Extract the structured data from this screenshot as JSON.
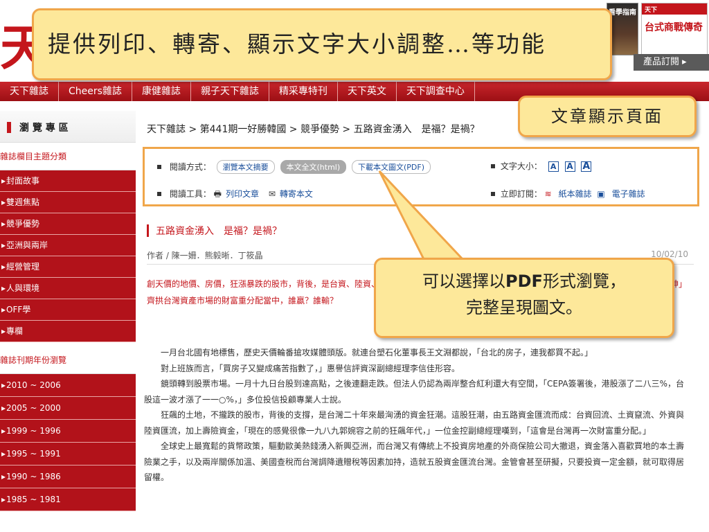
{
  "header": {
    "logo_glyph": "天",
    "magazine_1_text": "看學指南",
    "magazine_2_top": "天下",
    "magazine_2_title": "台式商戰傳奇",
    "subscribe_label": "產品訂閱"
  },
  "nav": {
    "items": [
      "天下雜誌",
      "Cheers雜誌",
      "康健雜誌",
      "親子天下雜誌",
      "精采專特刊",
      "天下英文",
      "天下調查中心"
    ]
  },
  "sidebar": {
    "title": "瀏 覽 專 區",
    "topics_head": "雜誌欄目主題分類",
    "topics": [
      "封面故事",
      "雙週焦點",
      "競爭優勢",
      "亞洲與兩岸",
      "經營管理",
      "人與環境",
      "OFF學",
      "專欄"
    ],
    "years_head": "雜誌刊期年份瀏覽",
    "years": [
      "2010 ~ 2006",
      "2005 ~ 2000",
      "1999 ~ 1996",
      "1995 ~ 1991",
      "1990 ~ 1986",
      "1985 ~ 1981"
    ]
  },
  "breadcrumb": "天下雜誌 > 第441期一好勝韓國 > 競爭優勢 > 五路資金湧入　是福？是禍？",
  "tools": {
    "read_mode_label": "閱讀方式：",
    "read_summary": "瀏覽本文摘要",
    "read_full": "本文全文(html)",
    "read_pdf": "下載本文圖文(PDF)",
    "font_size_label": "文字大小：",
    "font_a": "A",
    "read_tools_label": "閱讀工具：",
    "print_label": "列印文章",
    "forward_label": "轉寄本文",
    "subscribe_label": "立即訂閱：",
    "paper_mag": "紙本雜誌",
    "e_mag": "電子雜誌"
  },
  "article": {
    "title": "五路資金湧入　是福？是禍？",
    "meta": "作者 / 陳一姍．熊毅晰．丁筱晶",
    "date": "10/02/10",
    "lead": "創天價的地價、房價，狂漲暴跌的股市，背後，是台資、陸資、外資、壽險資金、熱錢集體湧入。這是台灣二十年來最大的資金潮。在「五路財神」齊拱台灣資產市場的財富重分配當中，誰贏？誰輸？",
    "paragraphs": [
      "一月台北國有地標售，歷史天價輪番搶攻媒體頭版。就連台塑石化董事長王文淵都說，「台北的房子，連我都買不起。」",
      "對上班族而言，「買房子又變成痛苦指數了，」惠譽信評資深副總經理李信佳形容。",
      "鏡頭轉到股票市場。一月十九日台股到達高點，之後連翻走跌。但法人仍認為兩岸整合紅利還大有空間，「CEPA簽署後，港股漲了二八三%，台股這一波才漲了一一○%，」多位投信投顧專業人士說。",
      "狂飆的土地，不攏跌的股市，背後的支撐，是台灣二十年來最洶湧的資金狂潮。這股狂潮，由五路資金匯流而成：台資回流、土資竄流、外資與陸資匯流，加上壽險資金，「現在的感覺很像一九八九郭婉容之前的狂飆年代，」一位金控副總經理嘆到，「這會是台灣再一次財富重分配。」",
      "全球史上最寬鬆的貨幣政策，驅動歐美熱錢湧入新興亞洲，而台灣又有傳統上不投資房地產的外商保險公司大撤退，資金落入喜歡買地的本土壽險業之手，以及兩岸關係加溫、美國查稅而台灣調降遺贈稅等因素加持，造就五股資金匯流台灣。金管會甚至研擬，只要投資一定金額，就可取得居留權。"
    ]
  },
  "callouts": {
    "features": "提供列印、轉寄、顯示文字大小調整…等功能",
    "page": "文章顯示頁面",
    "pdf_line1_a": "可以選擇以",
    "pdf_line1_b": "PDF",
    "pdf_line1_c": "形式瀏覽，",
    "pdf_line2": "完整呈現圖文。"
  },
  "colors": {
    "brand_red": "#c4161c",
    "callout_fill": "#fde89a",
    "callout_border": "#f0a64a",
    "link_blue": "#1a4f9b"
  }
}
